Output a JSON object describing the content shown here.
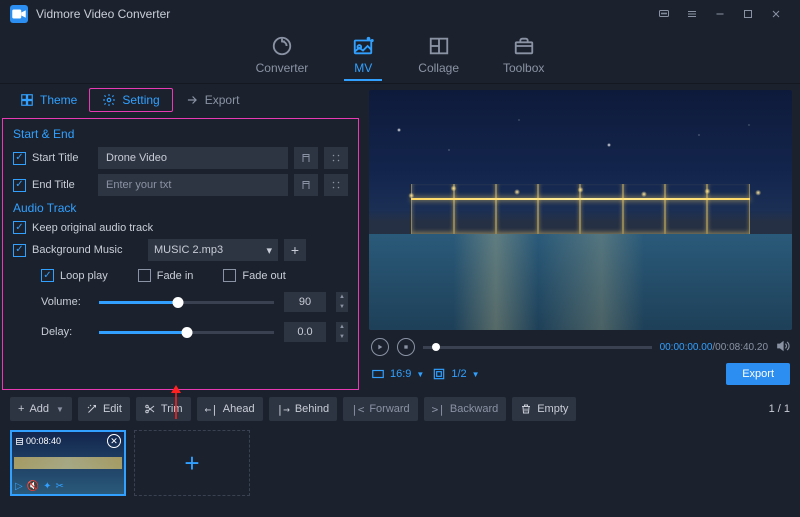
{
  "app": {
    "name": "Vidmore Video Converter"
  },
  "toptabs": {
    "converter": "Converter",
    "mv": "MV",
    "collage": "Collage",
    "toolbox": "Toolbox"
  },
  "subtabs": {
    "theme": "Theme",
    "setting": "Setting",
    "export": "Export"
  },
  "settings": {
    "start_end_title": "Start & End",
    "start_title_label": "Start Title",
    "start_title_value": "Drone Video",
    "end_title_label": "End Title",
    "end_title_placeholder": "Enter your txt",
    "audio_track_title": "Audio Track",
    "keep_original_label": "Keep original audio track",
    "bg_music_label": "Background Music",
    "bg_music_value": "MUSIC 2.mp3",
    "loop_label": "Loop play",
    "fadein_label": "Fade in",
    "fadeout_label": "Fade out",
    "volume_label": "Volume:",
    "volume_value": "90",
    "delay_label": "Delay:",
    "delay_value": "0.0"
  },
  "preview": {
    "current_time": "00:00:00.00",
    "total_time": "00:08:40.20",
    "aspect": "16:9",
    "fraction": "1/2",
    "export_btn": "Export"
  },
  "toolbar": {
    "add": "Add",
    "edit": "Edit",
    "trim": "Trim",
    "ahead": "Ahead",
    "behind": "Behind",
    "forward": "Forward",
    "backward": "Backward",
    "empty": "Empty",
    "page": "1 / 1"
  },
  "clip": {
    "duration": "00:08:40"
  }
}
